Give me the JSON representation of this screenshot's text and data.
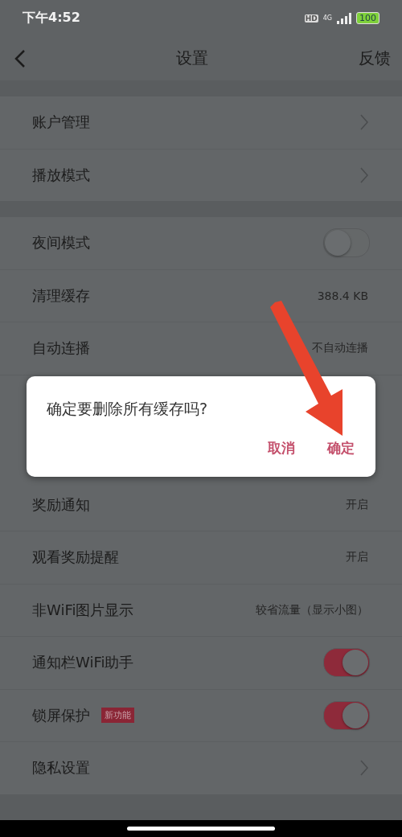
{
  "status_bar": {
    "time": "下午4:52",
    "hd": "HD",
    "network": "4G",
    "battery": "100"
  },
  "nav": {
    "title": "设置",
    "action": "反馈"
  },
  "groups": [
    {
      "rows": [
        {
          "kind": "chevron",
          "label": "账户管理"
        },
        {
          "kind": "chevron",
          "label": "播放模式"
        }
      ]
    },
    {
      "rows": [
        {
          "kind": "toggle",
          "label": "夜间模式",
          "on": false
        },
        {
          "kind": "value",
          "label": "清理缓存",
          "value": "388.4 KB"
        },
        {
          "kind": "value",
          "label": "自动连播",
          "value": "不自动连播"
        },
        {
          "kind": "hidden"
        },
        {
          "kind": "hidden"
        },
        {
          "kind": "value",
          "label": "奖励通知",
          "value": "开启"
        },
        {
          "kind": "value",
          "label": "观看奖励提醒",
          "value": "开启"
        },
        {
          "kind": "value",
          "label": "非WiFi图片显示",
          "value": "较省流量（显示小图）"
        },
        {
          "kind": "toggle",
          "label": "通知栏WiFi助手",
          "on": true
        },
        {
          "kind": "toggle",
          "label": "锁屏保护",
          "badge": "新功能",
          "on": true
        },
        {
          "kind": "chevron",
          "label": "隐私设置"
        }
      ]
    }
  ],
  "dialog": {
    "message": "确定要删除所有缓存吗?",
    "buttons": [
      "取消",
      "确定"
    ]
  }
}
